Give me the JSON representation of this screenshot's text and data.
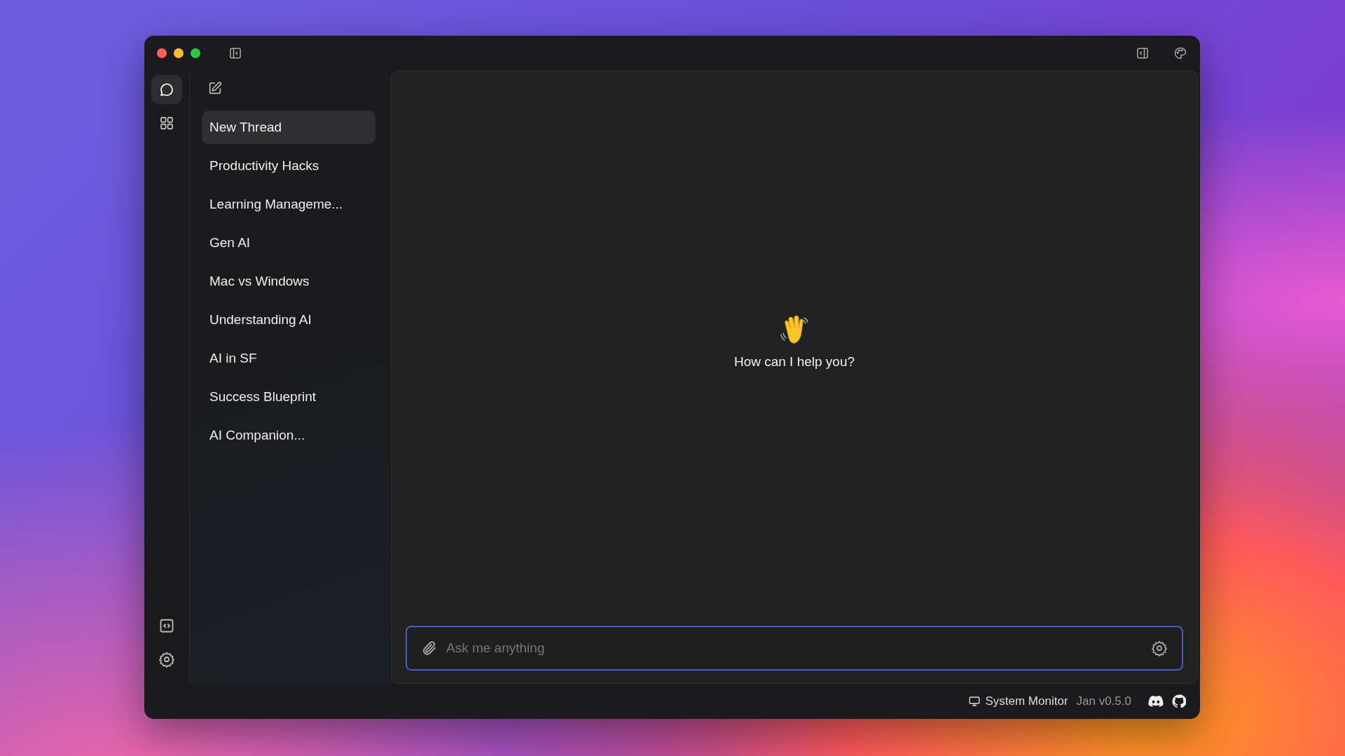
{
  "rail": {
    "top": [
      {
        "kind": "chat",
        "selected": true
      },
      {
        "kind": "grid",
        "selected": false
      }
    ],
    "bottom": [
      {
        "kind": "code",
        "selected": false
      },
      {
        "kind": "settings",
        "selected": false
      }
    ]
  },
  "threads": [
    {
      "title": "New Thread",
      "selected": true
    },
    {
      "title": "Productivity Hacks",
      "selected": false
    },
    {
      "title": "Learning Manageme...",
      "selected": false
    },
    {
      "title": "Gen AI",
      "selected": false
    },
    {
      "title": "Mac vs Windows",
      "selected": false
    },
    {
      "title": "Understanding AI",
      "selected": false
    },
    {
      "title": "AI in SF",
      "selected": false
    },
    {
      "title": "Success Blueprint",
      "selected": false
    },
    {
      "title": "AI Companion...",
      "selected": false
    }
  ],
  "main": {
    "greeting": "How can I help you?",
    "input": {
      "placeholder": "Ask me anything"
    }
  },
  "status_bar": {
    "system_monitor": "System Monitor",
    "version": "Jan v0.5.0"
  }
}
